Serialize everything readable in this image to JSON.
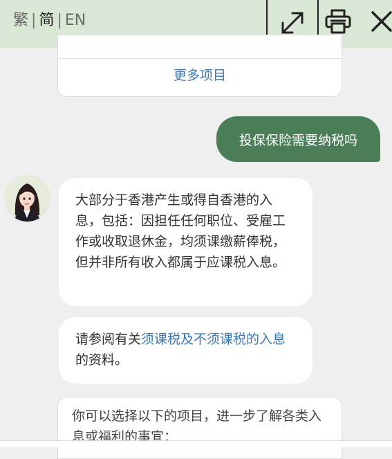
{
  "header": {
    "lang_traditional": "繁",
    "lang_simplified": "简",
    "lang_english": "EN",
    "separator": "|",
    "expand_icon": "expand-icon",
    "print_icon": "printer-icon",
    "close_icon": "close-icon"
  },
  "top_card": {
    "more_label": "更多项目"
  },
  "user_message": "投保保险需要纳税吗",
  "bot_messages": {
    "answer": "大部分于香港产生或得自香港的入息，包括：因担任任何职位、受雇工作或收取退休金，均须课缴薪俸税，但并非所有收入都属于应课税入息。",
    "ref_prefix": "请参阅有关",
    "ref_link": "须课税及不须课税的入息",
    "ref_suffix": "的资料。"
  },
  "bottom_card": {
    "text": "你可以选择以下的项目，进一步了解各类入息或福利的事宜："
  },
  "colors": {
    "header_bg": "#d9e8d4",
    "user_bubble": "#4b7d57",
    "link": "#3a78b5"
  }
}
